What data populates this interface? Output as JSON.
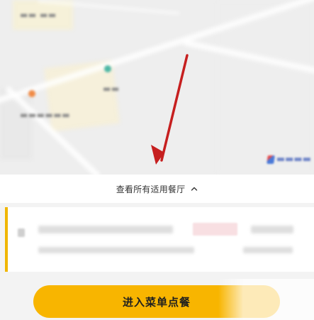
{
  "map": {
    "icons": [
      "map-poi-icon",
      "map-provider-logo-icon"
    ]
  },
  "restaurants_toggle": {
    "label": "查看所有适用餐厅",
    "icon": "chevron-up-icon"
  },
  "actions": {
    "order_button_label": "进入菜单点餐"
  },
  "colors": {
    "accent": "#f8b500",
    "card_accent": "#f0b600",
    "arrow": "#c61f1f",
    "background": "#f3f3f3"
  }
}
